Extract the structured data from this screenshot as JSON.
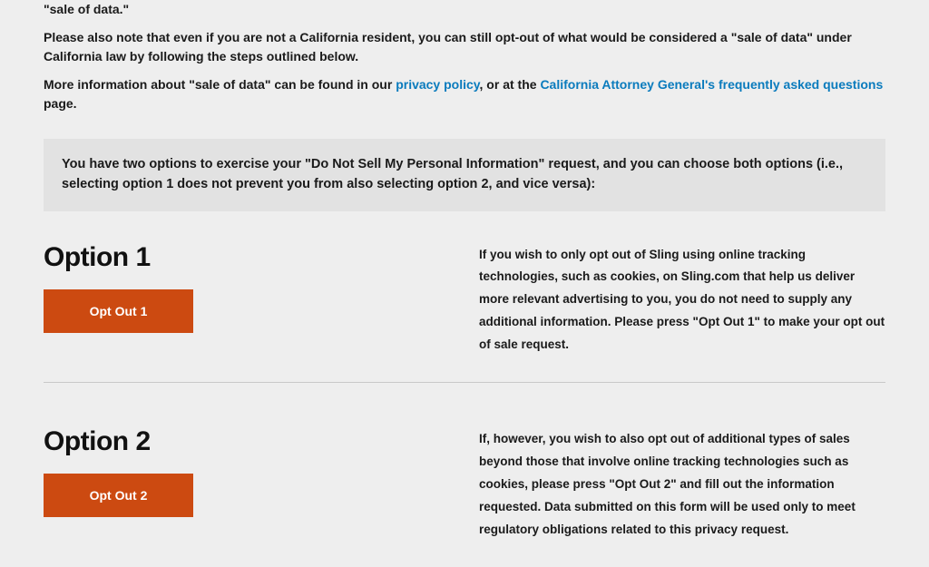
{
  "intro": {
    "frag0": "\"sale of data.\"",
    "p2": "Please also note that even if you are not a California resident, you can still opt-out of what would be considered a \"sale of data\" under California law by following the steps outlined below.",
    "p3_a": "More information about \"sale of data\" can be found in our ",
    "p3_link1": "privacy policy",
    "p3_b": ", or at the ",
    "p3_link2": "California Attorney General's frequently asked questions",
    "p3_c": " page."
  },
  "notice": "You have two options to exercise your \"Do Not Sell My Personal Information\" request, and you can choose both options (i.e., selecting option 1 does not prevent you from also selecting option 2, and vice versa):",
  "options": {
    "opt1": {
      "title": "Option 1",
      "button": "Opt Out 1",
      "desc": "If you wish to only opt out of Sling using online tracking technologies, such as cookies, on Sling.com that help us deliver more relevant advertising to you, you do not need to supply any additional information. Please press \"Opt Out 1\" to make your opt out of sale request."
    },
    "opt2": {
      "title": "Option 2",
      "button": "Opt Out 2",
      "desc": "If, however, you wish to also opt out of additional types of sales beyond those that involve online tracking technologies such as cookies, please press \"Opt Out 2\" and fill out the information requested. Data submitted on this form will be used only to meet regulatory obligations related to this privacy request."
    }
  }
}
